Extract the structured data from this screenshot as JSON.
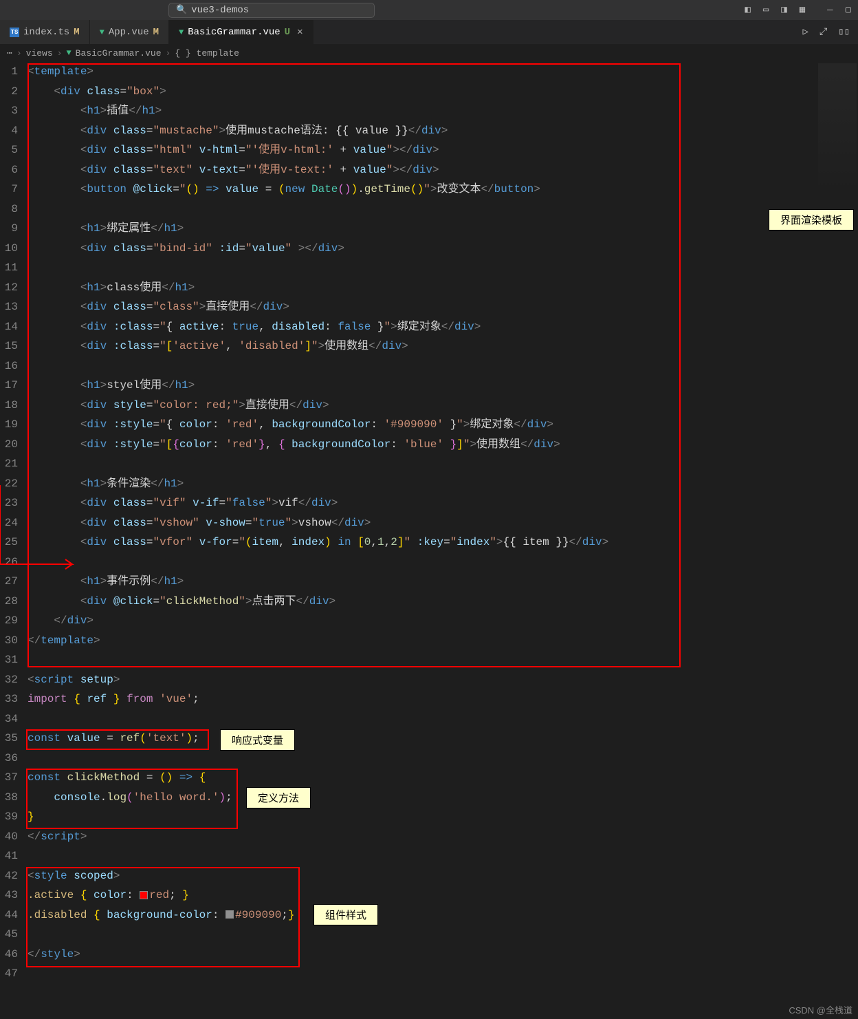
{
  "title_bar": {
    "search_placeholder": "vue3-demos"
  },
  "tabs": [
    {
      "icon": "ts",
      "label": "index.ts",
      "status": "M",
      "active": false
    },
    {
      "icon": "vue",
      "label": "App.vue",
      "status": "M",
      "active": false
    },
    {
      "icon": "vue",
      "label": "BasicGrammar.vue",
      "status": "U",
      "active": true
    }
  ],
  "breadcrumb": {
    "items": [
      "...",
      "views",
      "BasicGrammar.vue",
      "{ } template"
    ],
    "vue_icon_index": 2
  },
  "gutter_lines": {
    "start": 1,
    "end": 47
  },
  "annotations": {
    "template": "界面渲染模板",
    "reactive_var": "响应式变量",
    "method_def": "定义方法",
    "style": "组件样式"
  },
  "code": {
    "l1": "<template>",
    "l2_class": "box",
    "l3_h1": "插值",
    "l4_class": "mustache",
    "l4_text_pre": "使用mustache语法: ",
    "l4_expr": "{{ value }}",
    "l5_class": "html",
    "l5_attr": "v-html",
    "l5_val": "'使用v-html:' + value",
    "l6_class": "text",
    "l6_attr": "v-text",
    "l6_val": "'使用v-text:' + value",
    "l7_attr": "@click",
    "l7_val": "() => value = (new Date()).getTime()",
    "l7_text": "改变文本",
    "l9_h1": "绑定属性",
    "l10_class": "bind-id",
    "l10_attr": ":id",
    "l10_val": "value",
    "l12_h1": "class使用",
    "l13_class": "class",
    "l13_text": "直接使用",
    "l14_attr": ":class",
    "l14_val_raw": "{ active: true, disabled: false }",
    "l14_text": "绑定对象",
    "l15_attr": ":class",
    "l15_val": "['active', 'disabled']",
    "l15_text": "使用数组",
    "l17_h1": "styel使用",
    "l18_attr": "style",
    "l18_val": "color: red;",
    "l18_text": "直接使用",
    "l19_attr": ":style",
    "l19_val": "{ color: 'red', backgroundColor: '#909090' }",
    "l19_text": "绑定对象",
    "l20_attr": ":style",
    "l20_val": "[{color: 'red'}, { backgroundColor: 'blue' }]",
    "l20_text": "使用数组",
    "l22_h1": "条件渲染",
    "l23_class": "vif",
    "l23_attr": "v-if",
    "l23_val": "false",
    "l23_text": "vif",
    "l24_class": "vshow",
    "l24_attr": "v-show",
    "l24_val": "true",
    "l24_text": "vshow",
    "l25_class": "vfor",
    "l25_attr": "v-for",
    "l25_val": "(item, index) in [0,1,2]",
    "l25_key": ":key",
    "l25_keyval": "index",
    "l25_expr": "{{ item }}",
    "l27_h1": "事件示例",
    "l28_attr": "@click",
    "l28_val": "clickMethod",
    "l28_text": "点击两下",
    "l32": "<script setup>",
    "l33": "import { ref } from 'vue';",
    "l35": "const value = ref('text');",
    "l37": "const clickMethod = () => {",
    "l38": "    console.log('hello word.');",
    "l39": "}",
    "l40": "</script>",
    "l42": "<style scoped>",
    "l43_sel": ".active",
    "l43_prop": "color",
    "l43_val": "red",
    "l43_color": "#ff0000",
    "l44_sel": ".disabled",
    "l44_prop": "background-color",
    "l44_val": "#909090",
    "l44_color": "#909090",
    "l46": "</style>"
  },
  "watermark": "CSDN @全栈道"
}
